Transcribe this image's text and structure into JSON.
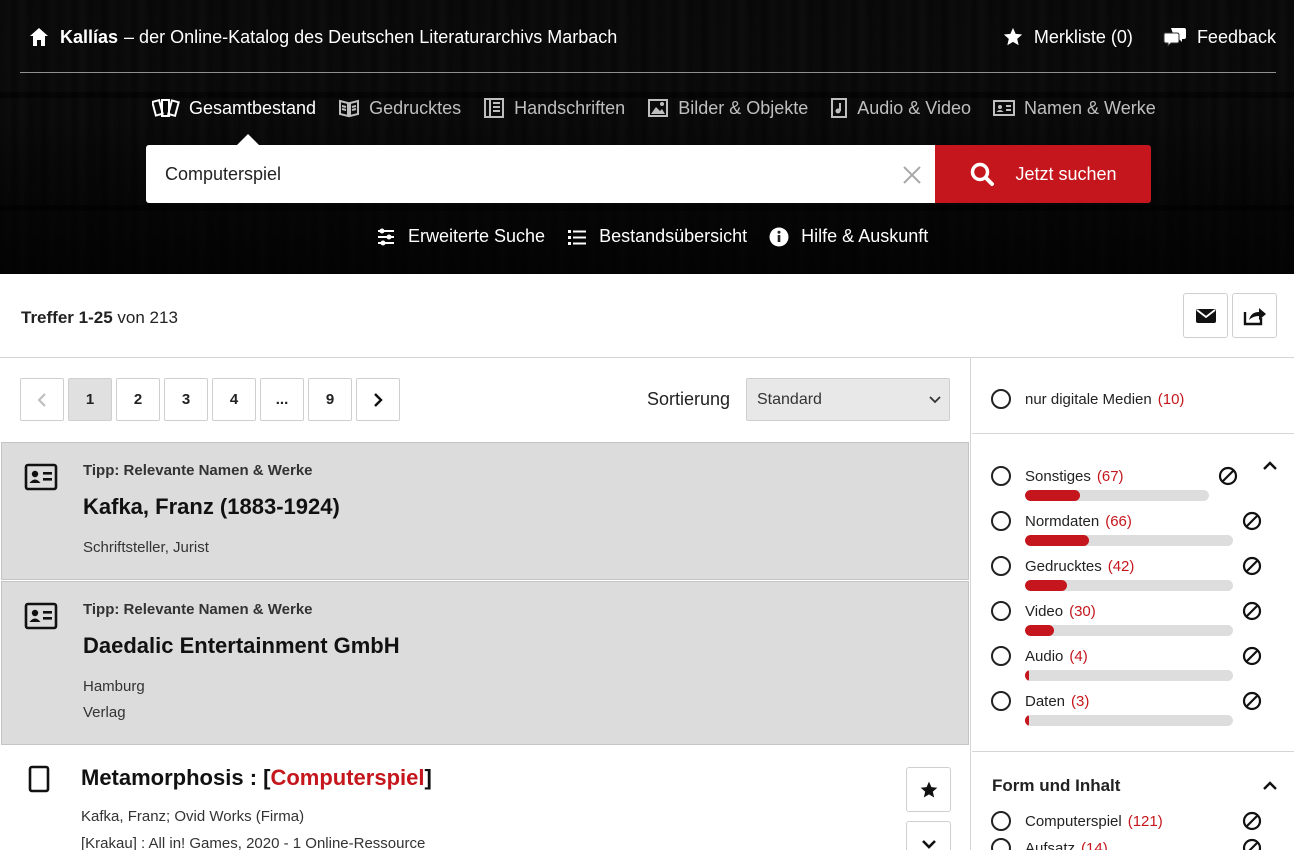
{
  "header": {
    "brand": "Kallías",
    "brand_suffix": "– der Online-Katalog des Deutschen Literaturarchivs Marbach",
    "merkliste": "Merkliste (0)",
    "feedback": "Feedback",
    "tabs": [
      {
        "label": "Gesamtbestand",
        "icon": "books-icon"
      },
      {
        "label": "Gedrucktes",
        "icon": "open-book-icon"
      },
      {
        "label": "Handschriften",
        "icon": "manuscript-icon"
      },
      {
        "label": "Bilder & Objekte",
        "icon": "image-icon"
      },
      {
        "label": "Audio & Video",
        "icon": "media-file-icon"
      },
      {
        "label": "Namen & Werke",
        "icon": "id-card-icon"
      }
    ],
    "active_tab": "Gesamtbestand"
  },
  "search": {
    "value": "Computerspiel",
    "button": "Jetzt suchen"
  },
  "sublinks": {
    "advanced": "Erweiterte Suche",
    "overview": "Bestandsübersicht",
    "help": "Hilfe & Auskunft"
  },
  "results": {
    "range_bold": "Treffer 1-25",
    "total": "von 213"
  },
  "pagination": {
    "pages": [
      "1",
      "2",
      "3",
      "4",
      "...",
      "9"
    ],
    "current": "1"
  },
  "sort": {
    "label": "Sortierung",
    "value": "Standard"
  },
  "tips": [
    {
      "kicker": "Tipp: Relevante Namen & Werke",
      "title": "Kafka, Franz (1883-1924)",
      "lines": [
        "Schriftsteller, Jurist"
      ]
    },
    {
      "kicker": "Tipp: Relevante Namen & Werke",
      "title": "Daedalic Entertainment GmbH",
      "lines": [
        "Hamburg",
        "Verlag"
      ]
    }
  ],
  "record": {
    "title_pre": "Metamorphosis : [",
    "title_hl": "Computerspiel",
    "title_post": "]",
    "authors": "Kafka, Franz; Ovid Works (Firma)",
    "pub": "[Krakau] : All in! Games, 2020 - 1 Online-Ressource"
  },
  "sidebar": {
    "digital": {
      "label": "nur digitale Medien",
      "count": "(10)"
    },
    "media": [
      {
        "label": "Sonstiges",
        "count": "(67)",
        "fraction": 0.3
      },
      {
        "label": "Normdaten",
        "count": "(66)",
        "fraction": 0.31
      },
      {
        "label": "Gedrucktes",
        "count": "(42)",
        "fraction": 0.2
      },
      {
        "label": "Video",
        "count": "(30)",
        "fraction": 0.14
      },
      {
        "label": "Audio",
        "count": "(4)",
        "fraction": 0.02
      },
      {
        "label": "Daten",
        "count": "(3)",
        "fraction": 0.02
      }
    ],
    "form_heading": "Form und Inhalt",
    "form": [
      {
        "label": "Computerspiel",
        "count": "(121)"
      },
      {
        "label": "Aufsatz",
        "count": "(14)"
      }
    ]
  },
  "colors": {
    "accent": "#c4161c",
    "tip_bg": "#dcdcdc",
    "bar_track": "#dddddd"
  }
}
